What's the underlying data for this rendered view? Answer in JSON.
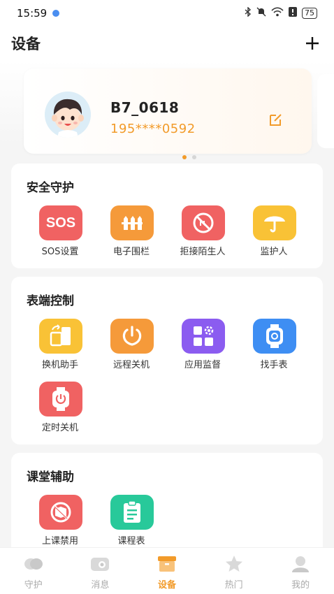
{
  "status_bar": {
    "time": "15:59",
    "battery": "75"
  },
  "header": {
    "title": "设备"
  },
  "device": {
    "name": "B7_0618",
    "phone": "195****0592"
  },
  "sections": {
    "safety": {
      "title": "安全守护",
      "items": [
        {
          "label": "SOS设置",
          "icon": "sos-icon",
          "glyph": "SOS"
        },
        {
          "label": "电子围栏",
          "icon": "fence-icon"
        },
        {
          "label": "拒接陌生人",
          "icon": "block-stranger-icon"
        },
        {
          "label": "监护人",
          "icon": "umbrella-icon"
        }
      ]
    },
    "control": {
      "title": "表端控制",
      "items": [
        {
          "label": "换机助手",
          "icon": "switch-device-icon"
        },
        {
          "label": "远程关机",
          "icon": "power-icon"
        },
        {
          "label": "应用监督",
          "icon": "app-monitor-icon"
        },
        {
          "label": "找手表",
          "icon": "find-watch-icon"
        },
        {
          "label": "定时关机",
          "icon": "timed-shutdown-icon"
        }
      ]
    },
    "classroom": {
      "title": "课堂辅助",
      "items": [
        {
          "label": "上课禁用",
          "icon": "class-disable-icon"
        },
        {
          "label": "课程表",
          "icon": "schedule-icon"
        }
      ]
    }
  },
  "tabs": [
    {
      "label": "守护",
      "icon": "guard-icon"
    },
    {
      "label": "消息",
      "icon": "message-icon"
    },
    {
      "label": "设备",
      "icon": "device-icon",
      "active": true
    },
    {
      "label": "热门",
      "icon": "hot-icon"
    },
    {
      "label": "我的",
      "icon": "profile-icon"
    }
  ],
  "colors": {
    "accent": "#f29b2a",
    "red": "#f06262",
    "orange": "#f59a3a",
    "yellow": "#f9c236",
    "purple": "#8b5cf0",
    "blue": "#3e8ef3",
    "green": "#28c99a"
  }
}
